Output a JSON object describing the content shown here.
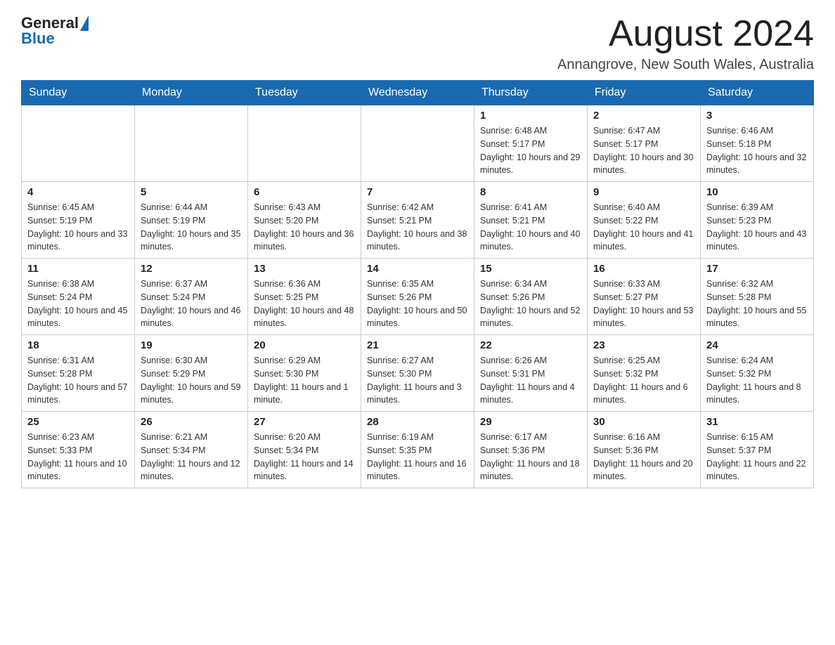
{
  "header": {
    "logo_general": "General",
    "logo_blue": "Blue",
    "month_title": "August 2024",
    "location": "Annangrove, New South Wales, Australia"
  },
  "days_of_week": [
    "Sunday",
    "Monday",
    "Tuesday",
    "Wednesday",
    "Thursday",
    "Friday",
    "Saturday"
  ],
  "weeks": [
    {
      "days": [
        {
          "number": "",
          "info": ""
        },
        {
          "number": "",
          "info": ""
        },
        {
          "number": "",
          "info": ""
        },
        {
          "number": "",
          "info": ""
        },
        {
          "number": "1",
          "info": "Sunrise: 6:48 AM\nSunset: 5:17 PM\nDaylight: 10 hours and 29 minutes."
        },
        {
          "number": "2",
          "info": "Sunrise: 6:47 AM\nSunset: 5:17 PM\nDaylight: 10 hours and 30 minutes."
        },
        {
          "number": "3",
          "info": "Sunrise: 6:46 AM\nSunset: 5:18 PM\nDaylight: 10 hours and 32 minutes."
        }
      ]
    },
    {
      "days": [
        {
          "number": "4",
          "info": "Sunrise: 6:45 AM\nSunset: 5:19 PM\nDaylight: 10 hours and 33 minutes."
        },
        {
          "number": "5",
          "info": "Sunrise: 6:44 AM\nSunset: 5:19 PM\nDaylight: 10 hours and 35 minutes."
        },
        {
          "number": "6",
          "info": "Sunrise: 6:43 AM\nSunset: 5:20 PM\nDaylight: 10 hours and 36 minutes."
        },
        {
          "number": "7",
          "info": "Sunrise: 6:42 AM\nSunset: 5:21 PM\nDaylight: 10 hours and 38 minutes."
        },
        {
          "number": "8",
          "info": "Sunrise: 6:41 AM\nSunset: 5:21 PM\nDaylight: 10 hours and 40 minutes."
        },
        {
          "number": "9",
          "info": "Sunrise: 6:40 AM\nSunset: 5:22 PM\nDaylight: 10 hours and 41 minutes."
        },
        {
          "number": "10",
          "info": "Sunrise: 6:39 AM\nSunset: 5:23 PM\nDaylight: 10 hours and 43 minutes."
        }
      ]
    },
    {
      "days": [
        {
          "number": "11",
          "info": "Sunrise: 6:38 AM\nSunset: 5:24 PM\nDaylight: 10 hours and 45 minutes."
        },
        {
          "number": "12",
          "info": "Sunrise: 6:37 AM\nSunset: 5:24 PM\nDaylight: 10 hours and 46 minutes."
        },
        {
          "number": "13",
          "info": "Sunrise: 6:36 AM\nSunset: 5:25 PM\nDaylight: 10 hours and 48 minutes."
        },
        {
          "number": "14",
          "info": "Sunrise: 6:35 AM\nSunset: 5:26 PM\nDaylight: 10 hours and 50 minutes."
        },
        {
          "number": "15",
          "info": "Sunrise: 6:34 AM\nSunset: 5:26 PM\nDaylight: 10 hours and 52 minutes."
        },
        {
          "number": "16",
          "info": "Sunrise: 6:33 AM\nSunset: 5:27 PM\nDaylight: 10 hours and 53 minutes."
        },
        {
          "number": "17",
          "info": "Sunrise: 6:32 AM\nSunset: 5:28 PM\nDaylight: 10 hours and 55 minutes."
        }
      ]
    },
    {
      "days": [
        {
          "number": "18",
          "info": "Sunrise: 6:31 AM\nSunset: 5:28 PM\nDaylight: 10 hours and 57 minutes."
        },
        {
          "number": "19",
          "info": "Sunrise: 6:30 AM\nSunset: 5:29 PM\nDaylight: 10 hours and 59 minutes."
        },
        {
          "number": "20",
          "info": "Sunrise: 6:29 AM\nSunset: 5:30 PM\nDaylight: 11 hours and 1 minute."
        },
        {
          "number": "21",
          "info": "Sunrise: 6:27 AM\nSunset: 5:30 PM\nDaylight: 11 hours and 3 minutes."
        },
        {
          "number": "22",
          "info": "Sunrise: 6:26 AM\nSunset: 5:31 PM\nDaylight: 11 hours and 4 minutes."
        },
        {
          "number": "23",
          "info": "Sunrise: 6:25 AM\nSunset: 5:32 PM\nDaylight: 11 hours and 6 minutes."
        },
        {
          "number": "24",
          "info": "Sunrise: 6:24 AM\nSunset: 5:32 PM\nDaylight: 11 hours and 8 minutes."
        }
      ]
    },
    {
      "days": [
        {
          "number": "25",
          "info": "Sunrise: 6:23 AM\nSunset: 5:33 PM\nDaylight: 11 hours and 10 minutes."
        },
        {
          "number": "26",
          "info": "Sunrise: 6:21 AM\nSunset: 5:34 PM\nDaylight: 11 hours and 12 minutes."
        },
        {
          "number": "27",
          "info": "Sunrise: 6:20 AM\nSunset: 5:34 PM\nDaylight: 11 hours and 14 minutes."
        },
        {
          "number": "28",
          "info": "Sunrise: 6:19 AM\nSunset: 5:35 PM\nDaylight: 11 hours and 16 minutes."
        },
        {
          "number": "29",
          "info": "Sunrise: 6:17 AM\nSunset: 5:36 PM\nDaylight: 11 hours and 18 minutes."
        },
        {
          "number": "30",
          "info": "Sunrise: 6:16 AM\nSunset: 5:36 PM\nDaylight: 11 hours and 20 minutes."
        },
        {
          "number": "31",
          "info": "Sunrise: 6:15 AM\nSunset: 5:37 PM\nDaylight: 11 hours and 22 minutes."
        }
      ]
    }
  ]
}
